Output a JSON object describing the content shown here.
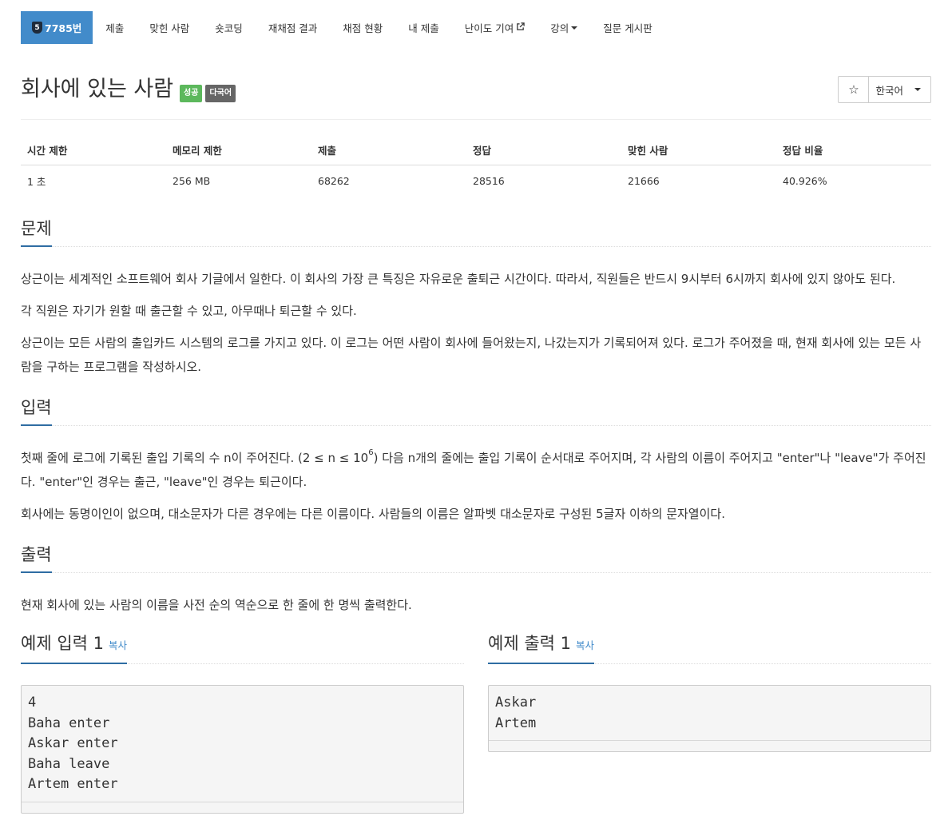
{
  "nav": {
    "problem_tab": {
      "tier_number": "5",
      "label": "7785번"
    },
    "tabs": [
      "제출",
      "맞힌 사람",
      "숏코딩",
      "재채점 결과",
      "채점 현황",
      "내 제출",
      "난이도 기여",
      "강의",
      "질문 게시판"
    ]
  },
  "problem": {
    "title": "회사에 있는 사람",
    "labels": [
      "성공",
      "다국어"
    ],
    "star": "☆",
    "language": "한국어"
  },
  "info": {
    "headers": [
      "시간 제한",
      "메모리 제한",
      "제출",
      "정답",
      "맞힌 사람",
      "정답 비율"
    ],
    "values": [
      "1 초",
      "256 MB",
      "68262",
      "28516",
      "21666",
      "40.926%"
    ]
  },
  "sections": {
    "description": {
      "heading": "문제",
      "p1": "상근이는 세계적인 소프트웨어 회사 기글에서 일한다. 이 회사의 가장 큰 특징은 자유로운 출퇴근 시간이다. 따라서, 직원들은 반드시 9시부터 6시까지 회사에 있지 않아도 된다.",
      "p2": "각 직원은 자기가 원할 때 출근할 수 있고, 아무때나 퇴근할 수 있다.",
      "p3": "상근이는 모든 사람의 출입카드 시스템의 로그를 가지고 있다. 이 로그는 어떤 사람이 회사에 들어왔는지, 나갔는지가 기록되어져 있다. 로그가 주어졌을 때, 현재 회사에 있는 모든 사람을 구하는 프로그램을 작성하시오."
    },
    "input": {
      "heading": "입력",
      "p1_a": "첫째 줄에 로그에 기록된 출입 기록의 수 n이 주어진다. (2 ≤ n ≤ 10",
      "p1_sup": "6",
      "p1_b": ") 다음 n개의 줄에는 출입 기록이 순서대로 주어지며, 각 사람의 이름이 주어지고 \"enter\"나 \"leave\"가 주어진다. \"enter\"인 경우는 출근, \"leave\"인 경우는 퇴근이다.",
      "p2": "회사에는 동명이인이 없으며, 대소문자가 다른 경우에는 다른 이름이다. 사람들의 이름은 알파벳 대소문자로 구성된 5글자 이하의 문자열이다."
    },
    "output": {
      "heading": "출력",
      "p1": "현재 회사에 있는 사람의 이름을 사전 순의 역순으로 한 줄에 한 명씩 출력한다."
    }
  },
  "samples": {
    "input": {
      "heading": "예제 입력 1",
      "copy": "복사",
      "text": "4\nBaha enter\nAskar enter\nBaha leave\nArtem enter"
    },
    "output": {
      "heading": "예제 출력 1",
      "copy": "복사",
      "text": "Askar\nArtem"
    }
  }
}
